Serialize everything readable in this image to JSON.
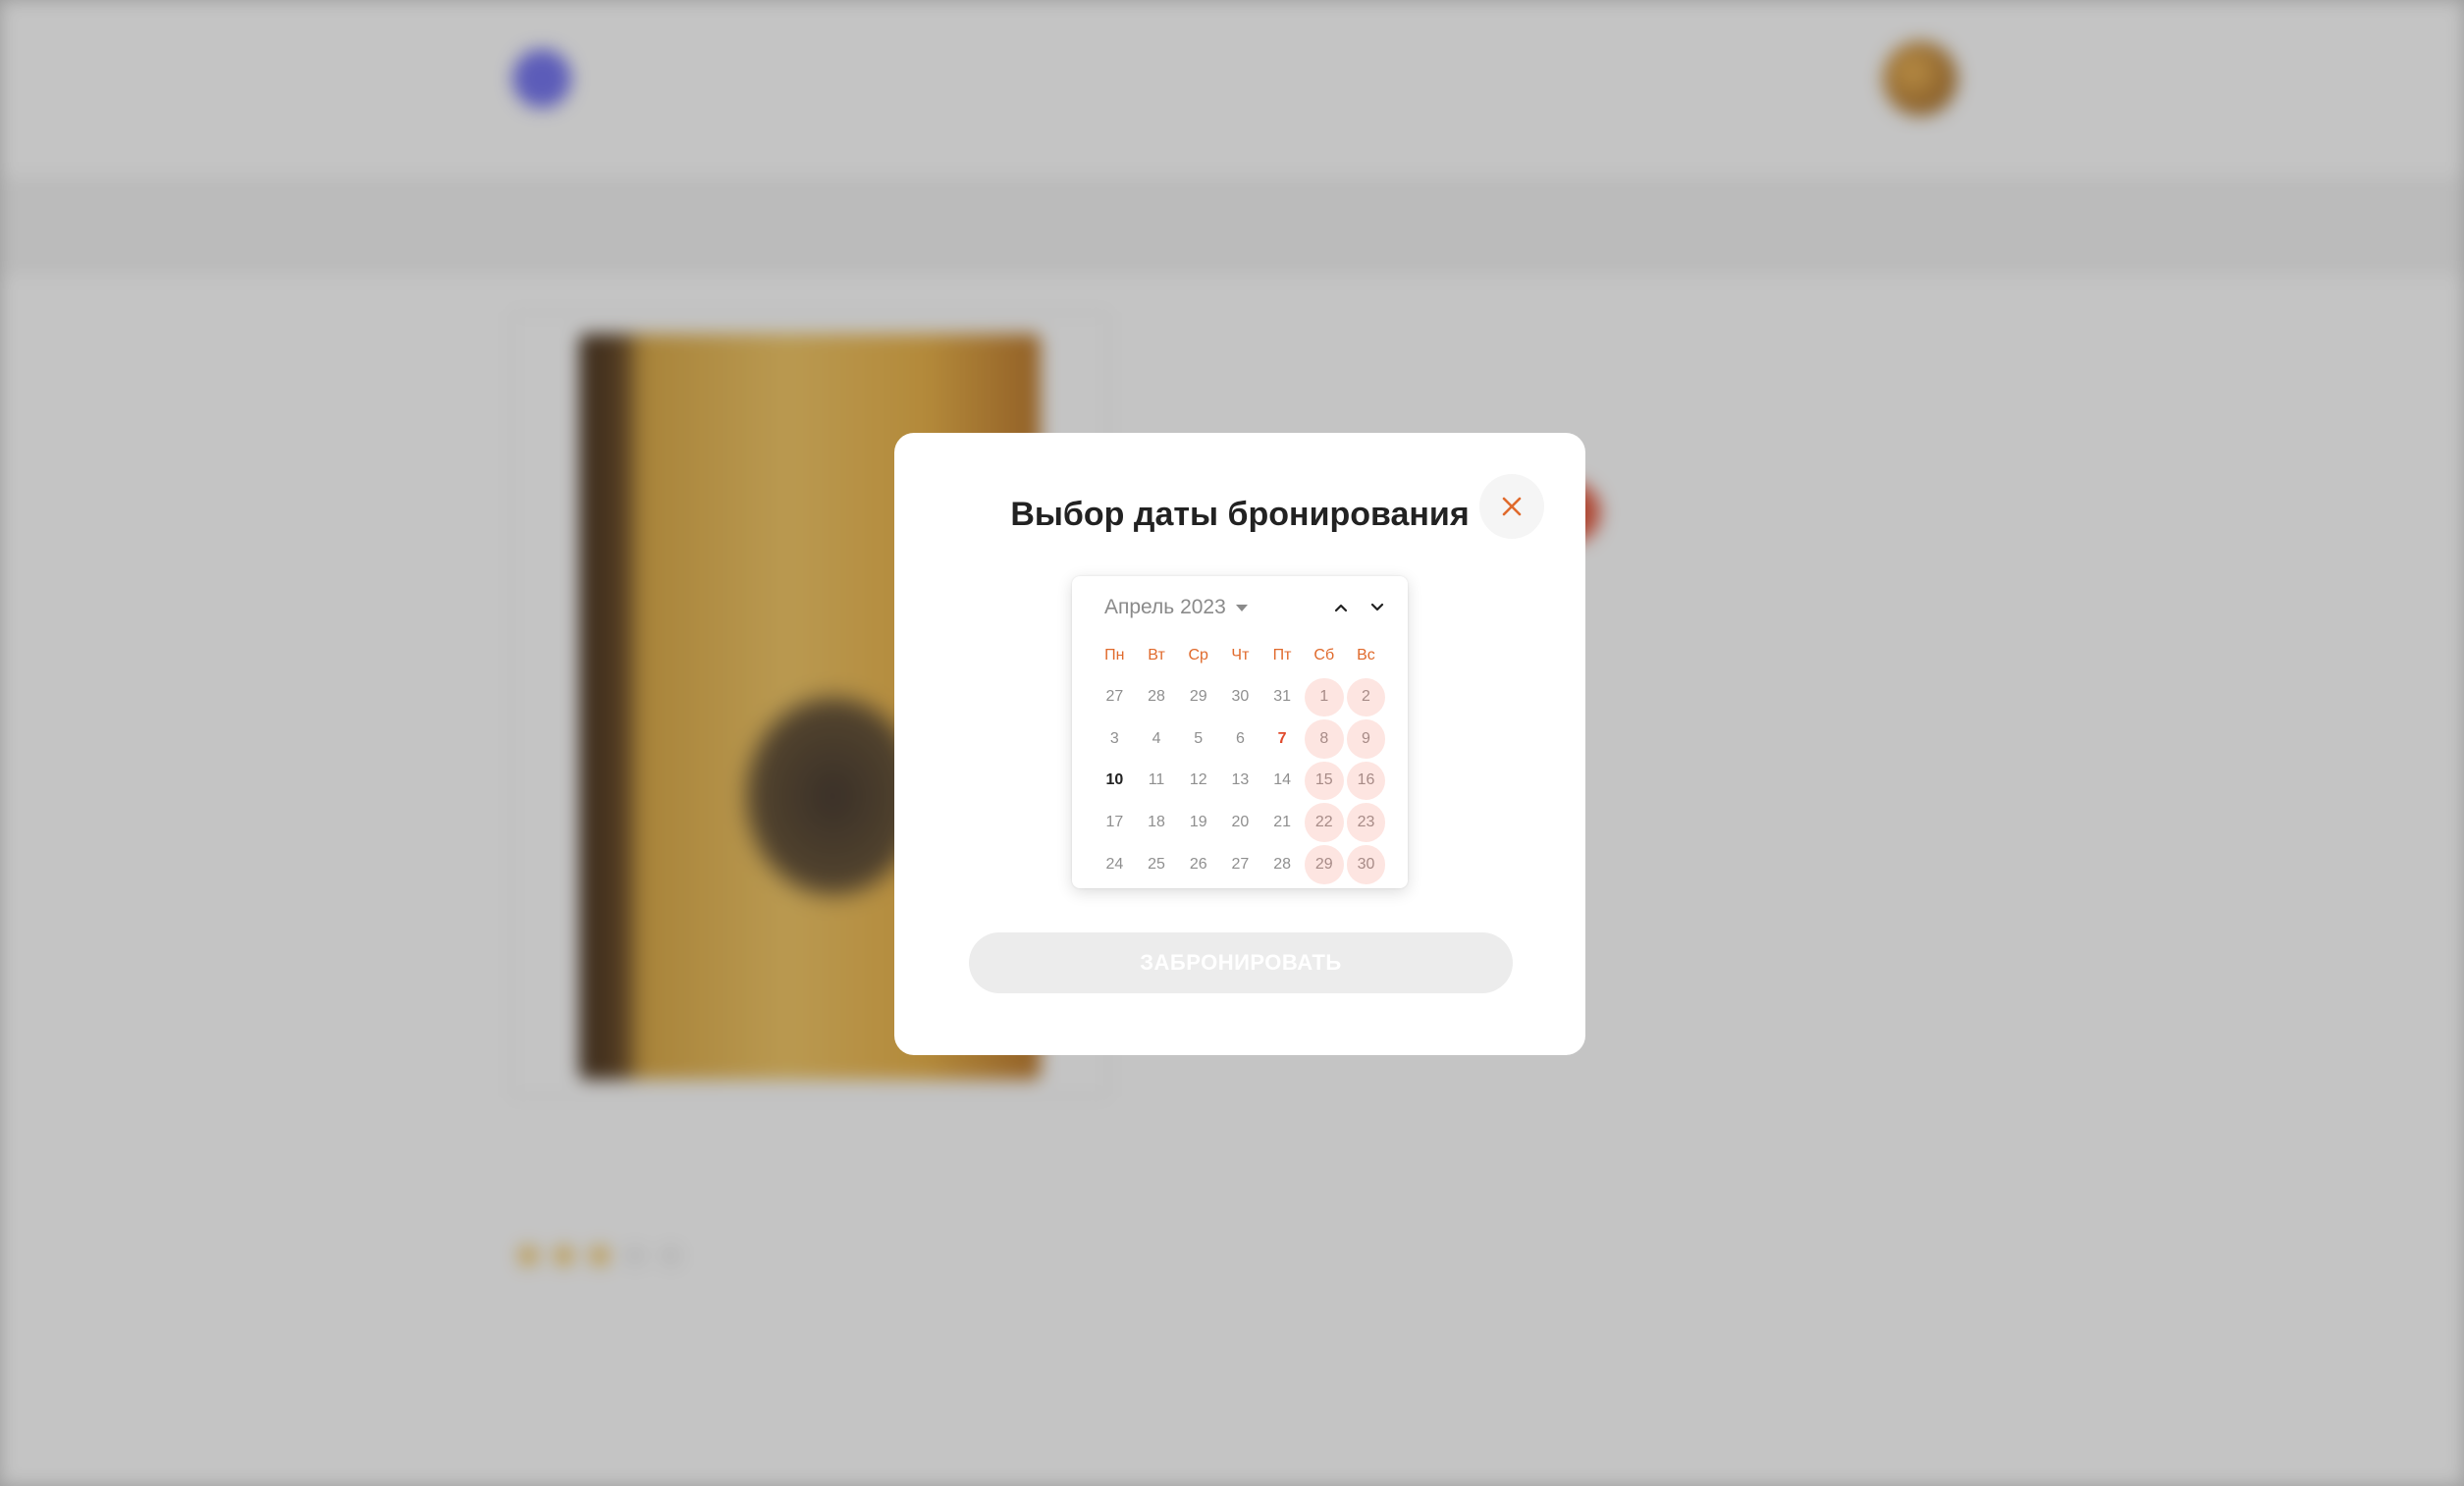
{
  "background": {
    "logo_text": "",
    "app_title": "",
    "user_name": "",
    "breadcrumbs": [],
    "book_title": "",
    "book_subtitle": "",
    "description": "",
    "rating_heading": "",
    "rating_value": "",
    "section_heading": "",
    "table_headers": []
  },
  "modal": {
    "title": "Выбор даты бронирования",
    "close_icon": "close-icon",
    "accent_color": "#e06a2c",
    "calendar": {
      "month_label": "Апрель 2023",
      "weekdays": [
        "Пн",
        "Вт",
        "Ср",
        "Чт",
        "Пт",
        "Сб",
        "Вс"
      ],
      "weeks": [
        [
          "27",
          "28",
          "29",
          "30",
          "31",
          "1",
          "2"
        ],
        [
          "3",
          "4",
          "5",
          "6",
          "7",
          "8",
          "9"
        ],
        [
          "10",
          "11",
          "12",
          "13",
          "14",
          "15",
          "16"
        ],
        [
          "17",
          "18",
          "19",
          "20",
          "21",
          "22",
          "23"
        ],
        [
          "24",
          "25",
          "26",
          "27",
          "28",
          "29",
          "30"
        ]
      ],
      "today": "7",
      "current_day": "10",
      "weekend_highlight_color": "#fde5e1"
    },
    "submit_label": "ЗАБРОНИРОВАТЬ"
  }
}
